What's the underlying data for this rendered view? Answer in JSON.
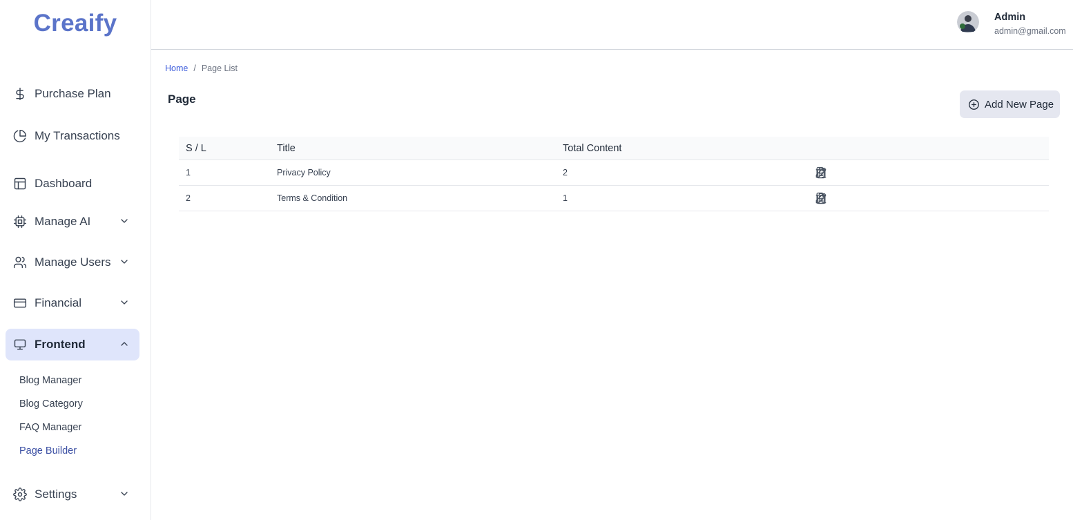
{
  "app": {
    "logo": "Creaify"
  },
  "sidebar": {
    "items": [
      {
        "label": "Purchase Plan",
        "icon": "dollar-icon"
      },
      {
        "label": "My Transactions",
        "icon": "pie-chart-icon"
      },
      {
        "label": "Dashboard",
        "icon": "layout-icon"
      },
      {
        "label": "Manage AI",
        "icon": "cpu-icon"
      },
      {
        "label": "Manage Users",
        "icon": "users-icon"
      },
      {
        "label": "Financial",
        "icon": "credit-card-icon"
      },
      {
        "label": "Frontend",
        "icon": "monitor-icon"
      },
      {
        "label": "Settings",
        "icon": "gear-icon"
      }
    ],
    "frontend_sub": [
      {
        "label": "Blog Manager"
      },
      {
        "label": "Blog Category"
      },
      {
        "label": "FAQ Manager"
      },
      {
        "label": "Page Builder"
      }
    ]
  },
  "header": {
    "user_name": "Admin",
    "user_email": "admin@gmail.com"
  },
  "breadcrumb": {
    "home": "Home",
    "separator": "/",
    "current": "Page List"
  },
  "main": {
    "title": "Page",
    "add_button": "Add New Page",
    "table": {
      "headers": [
        "S / L",
        "Title",
        "Total Content"
      ],
      "rows": [
        {
          "sl": "1",
          "title": "Privacy Policy",
          "total": "2"
        },
        {
          "sl": "2",
          "title": "Terms & Condition",
          "total": "1"
        }
      ]
    }
  },
  "colors": {
    "accent": "#5b74c9",
    "active_bg": "#dfe5fb",
    "link": "#3b5bdb"
  }
}
